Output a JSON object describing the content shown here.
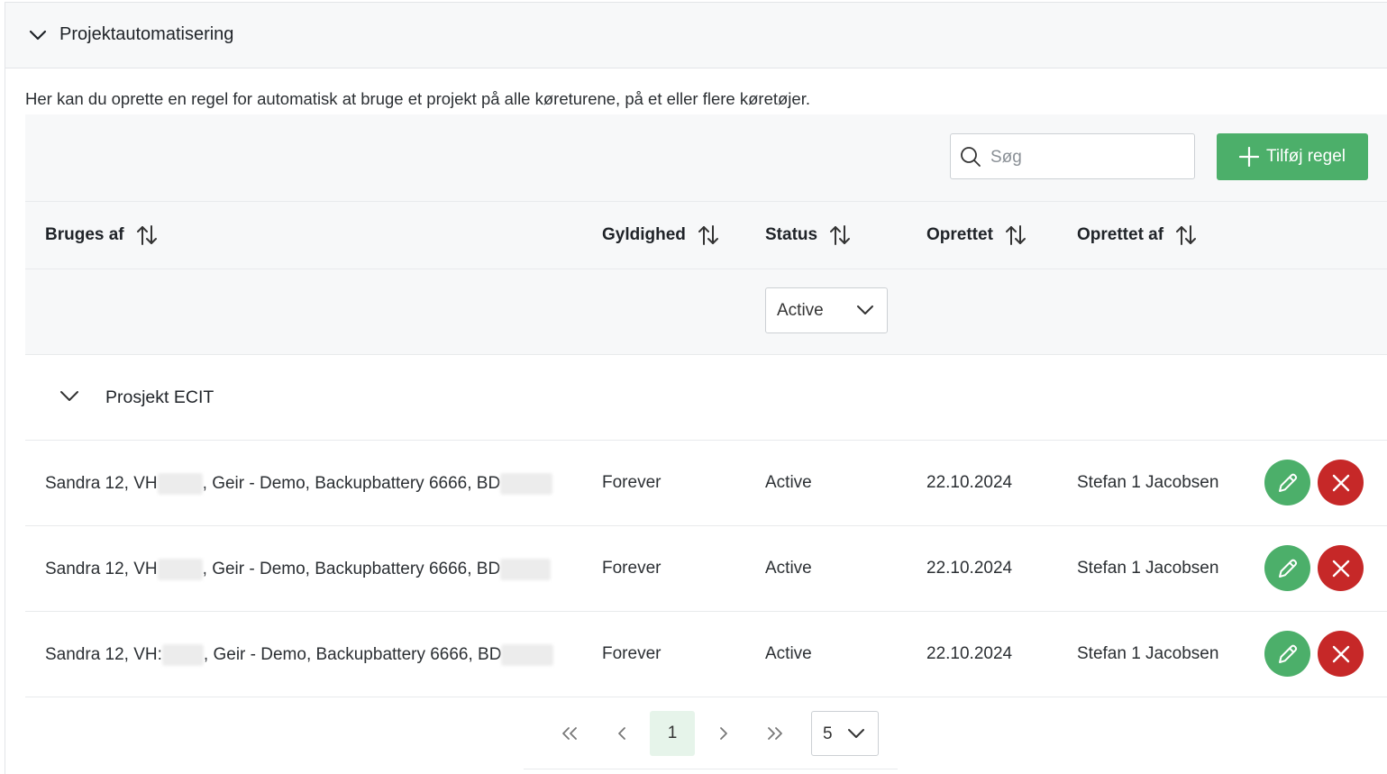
{
  "section": {
    "title": "Projektautomatisering",
    "description": "Her kan du oprette en regel for automatisk at bruge et projekt på alle køreturene, på et eller flere køretøjer."
  },
  "toolbar": {
    "search_placeholder": "Søg",
    "add_button_label": "Tilføj regel"
  },
  "columns": {
    "used_by": "Bruges af",
    "validity": "Gyldighed",
    "status": "Status",
    "created": "Oprettet",
    "created_by": "Oprettet af"
  },
  "filters": {
    "status_selected": "Active"
  },
  "group": {
    "label": "Prosjekt ECIT"
  },
  "rows": [
    {
      "used_by_part1": "Sandra 12, VH",
      "used_by_part2": ", Geir - Demo, Backupbattery 6666, BD",
      "validity": "Forever",
      "status": "Active",
      "created": "22.10.2024",
      "created_by": "Stefan 1 Jacobsen"
    },
    {
      "used_by_part1": "Sandra 12, VH",
      "used_by_part2": ", Geir - Demo, Backupbattery 6666, BD",
      "validity": "Forever",
      "status": "Active",
      "created": "22.10.2024",
      "created_by": "Stefan 1 Jacobsen"
    },
    {
      "used_by_part1": "Sandra 12, VH:",
      "used_by_part2": ", Geir - Demo, Backupbattery 6666, BD",
      "validity": "Forever",
      "status": "Active",
      "created": "22.10.2024",
      "created_by": "Stefan 1 Jacobsen"
    }
  ],
  "pagination": {
    "current_page": "1",
    "page_size": "5"
  },
  "colors": {
    "accent_green": "#4caf6a",
    "danger_red": "#c62828",
    "header_bg": "#f7f8f9"
  },
  "icons": {
    "section_toggle": "chevron-down-icon",
    "search": "search-icon",
    "add": "plus-icon",
    "sort": "sort-icon",
    "edit": "pencil-icon",
    "delete": "close-icon"
  }
}
